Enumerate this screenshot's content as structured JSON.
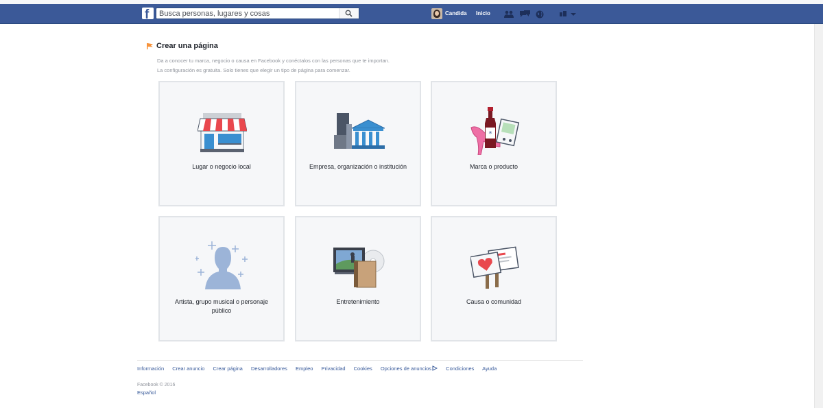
{
  "header": {
    "search_placeholder": "Busca personas, lugares y cosas",
    "user_name": "Candida",
    "home_label": "Inicio"
  },
  "page": {
    "title": "Crear una página",
    "description_line1": "Da a conocer tu marca, negocio o causa en Facebook y conéctalos con las personas que te importan.",
    "description_line2": "La configuración es gratuita. Solo tienes que elegir un tipo de página para comenzar."
  },
  "categories": [
    {
      "label": "Lugar o negocio local",
      "icon": "storefront-icon"
    },
    {
      "label": "Empresa, organización o institución",
      "icon": "buildings-icon"
    },
    {
      "label": "Marca o producto",
      "icon": "products-icon"
    },
    {
      "label": "Artista, grupo musical o personaje",
      "label2": "público",
      "icon": "person-sparkle-icon"
    },
    {
      "label": "Entretenimiento",
      "icon": "entertainment-icon"
    },
    {
      "label": "Causa o comunidad",
      "icon": "signs-icon"
    }
  ],
  "footer": {
    "links": [
      "Información",
      "Crear anuncio",
      "Crear página",
      "Desarrolladores",
      "Empleo",
      "Privacidad",
      "Cookies",
      "Opciones de anuncios",
      "Condiciones",
      "Ayuda"
    ],
    "copyright": "Facebook © 2016",
    "language": "Español"
  }
}
